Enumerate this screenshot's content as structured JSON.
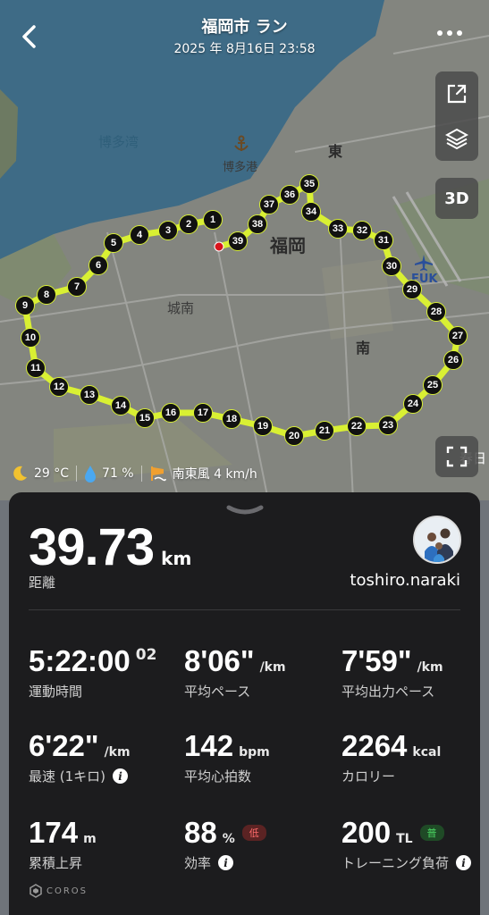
{
  "header": {
    "title": "福岡市 ラン",
    "datetime": "2025 年 8月16日 23:58"
  },
  "map": {
    "labels": {
      "bay": "博多湾",
      "port": "博多港",
      "east": "東",
      "fukuoka": "福岡",
      "jonan": "城南",
      "minami": "南",
      "fuk": "FUK",
      "kasuga": "春日"
    },
    "markers": [
      "1",
      "2",
      "3",
      "4",
      "5",
      "6",
      "7",
      "8",
      "9",
      "10",
      "11",
      "12",
      "13",
      "14",
      "15",
      "16",
      "17",
      "18",
      "19",
      "20",
      "21",
      "22",
      "23",
      "24",
      "25",
      "26",
      "27",
      "28",
      "29",
      "30",
      "31",
      "32",
      "33",
      "34",
      "35",
      "36",
      "37",
      "38",
      "39"
    ],
    "three_d_label": "3D",
    "route_color": "#d9f033"
  },
  "weather": {
    "temperature": "29 °C",
    "humidity": "71 %",
    "wind": "南東風 4 km/h"
  },
  "summary": {
    "distance": "39.73",
    "distance_unit": "km",
    "distance_label": "距離",
    "username": "toshiro.naraki"
  },
  "stats": {
    "duration": {
      "value": "5:22:00",
      "fraction": "02",
      "label": "運動時間"
    },
    "avg_pace": {
      "value": "8'06\"",
      "unit": "/km",
      "label": "平均ペース"
    },
    "avg_power_pace": {
      "value": "7'59\"",
      "unit": "/km",
      "label": "平均出力ペース"
    },
    "fastest": {
      "value": "6'22\"",
      "unit": "/km",
      "label": "最速 (1キロ)"
    },
    "heart_rate": {
      "value": "142",
      "unit": "bpm",
      "label": "平均心拍数"
    },
    "calories": {
      "value": "2264",
      "unit": "kcal",
      "label": "カロリー"
    },
    "elevation": {
      "value": "174",
      "unit": "m",
      "label": "累積上昇"
    },
    "efficiency": {
      "value": "88",
      "unit": "%",
      "badge": "低",
      "label": "効率"
    },
    "training_load": {
      "value": "200",
      "unit": "TL",
      "badge": "普",
      "label": "トレーニング負荷"
    }
  },
  "brand": "COROS"
}
